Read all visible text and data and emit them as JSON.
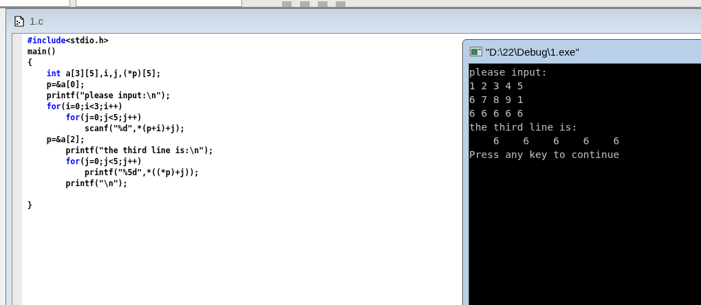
{
  "document": {
    "title": "1.c"
  },
  "code_lines": [
    [
      {
        "kind": "keyword",
        "text": "#include"
      },
      {
        "kind": "plain",
        "text": "<stdio.h>"
      }
    ],
    [
      {
        "kind": "plain",
        "text": "main()"
      }
    ],
    [
      {
        "kind": "plain",
        "text": "{"
      }
    ],
    [
      {
        "kind": "keyword",
        "text": "    int"
      },
      {
        "kind": "plain",
        "text": " a[3][5],i,j,(*p)[5];"
      }
    ],
    [
      {
        "kind": "plain",
        "text": "    p=&a[0];"
      }
    ],
    [
      {
        "kind": "plain",
        "text": "    printf(\"please input:\\n\");"
      }
    ],
    [
      {
        "kind": "keyword",
        "text": "    for"
      },
      {
        "kind": "plain",
        "text": "(i=0;i<3;i++)"
      }
    ],
    [
      {
        "kind": "keyword",
        "text": "        for"
      },
      {
        "kind": "plain",
        "text": "(j=0;j<5;j++)"
      }
    ],
    [
      {
        "kind": "plain",
        "text": "            scanf(\"%d\",*(p+i)+j);"
      }
    ],
    [
      {
        "kind": "plain",
        "text": "    p=&a[2];"
      }
    ],
    [
      {
        "kind": "plain",
        "text": "        printf(\"the third line is:\\n\");"
      }
    ],
    [
      {
        "kind": "keyword",
        "text": "        for"
      },
      {
        "kind": "plain",
        "text": "(j=0;j<5;j++)"
      }
    ],
    [
      {
        "kind": "plain",
        "text": "            printf(\"%5d\",*((*p)+j));"
      }
    ],
    [
      {
        "kind": "plain",
        "text": "        printf(\"\\n\");"
      }
    ],
    [
      {
        "kind": "blank"
      }
    ],
    [
      {
        "kind": "plain",
        "text": "}"
      }
    ]
  ],
  "console": {
    "title": "\"D:\\22\\Debug\\1.exe\"",
    "lines": [
      "please input:",
      "1 2 3 4 5",
      "6 7 8 9 1",
      "6 6 6 6 6",
      "the third line is:",
      "    6    6    6    6    6",
      "Press any key to continue"
    ]
  }
}
